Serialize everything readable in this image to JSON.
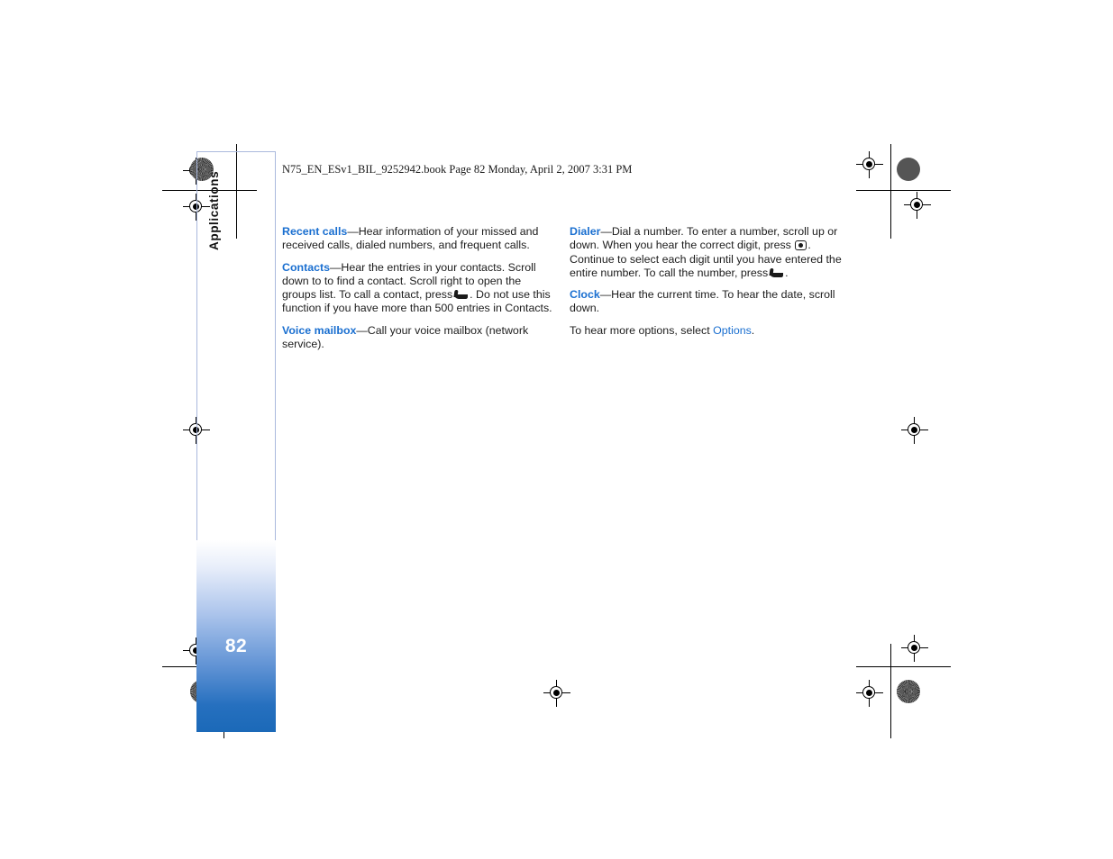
{
  "document": {
    "book_header": "N75_EN_ESv1_BIL_9252942.book  Page 82  Monday, April 2, 2007  3:31 PM",
    "page_number": "82",
    "tab_label": "Applications",
    "accent_color": "#1a6fd0",
    "page_bar_color": "#1b69b8"
  },
  "columns": {
    "left": [
      {
        "heading": "Recent calls",
        "dash": "—",
        "body": "Hear information of your missed and received calls, dialed numbers, and frequent calls."
      },
      {
        "heading": "Contacts",
        "dash": "—",
        "body_part1": "Hear the entries in your contacts. Scroll down to to find a contact. Scroll right to open the groups list. To call a contact, press",
        "icon": "call-key-icon",
        "body_part2": ". Do not use this function if you have more than 500 entries in Contacts."
      },
      {
        "heading": "Voice mailbox",
        "dash": "—",
        "body": "Call your voice mailbox (network service)."
      }
    ],
    "right": [
      {
        "heading": "Dialer",
        "dash": "—",
        "body_part1": "Dial a number. To enter a number, scroll up or down. When you hear the correct digit, press",
        "icon1": "scroll-key-icon",
        "body_part2": ". Continue to select each digit until you have entered the entire number. To call the number, press",
        "icon2": "call-key-icon",
        "body_part3": "."
      },
      {
        "heading": "Clock",
        "dash": "—",
        "body": "Hear the current time. To hear the date, scroll down."
      },
      {
        "body_part1": "To hear more options, select ",
        "link": "Options",
        "body_part2": "."
      }
    ]
  }
}
